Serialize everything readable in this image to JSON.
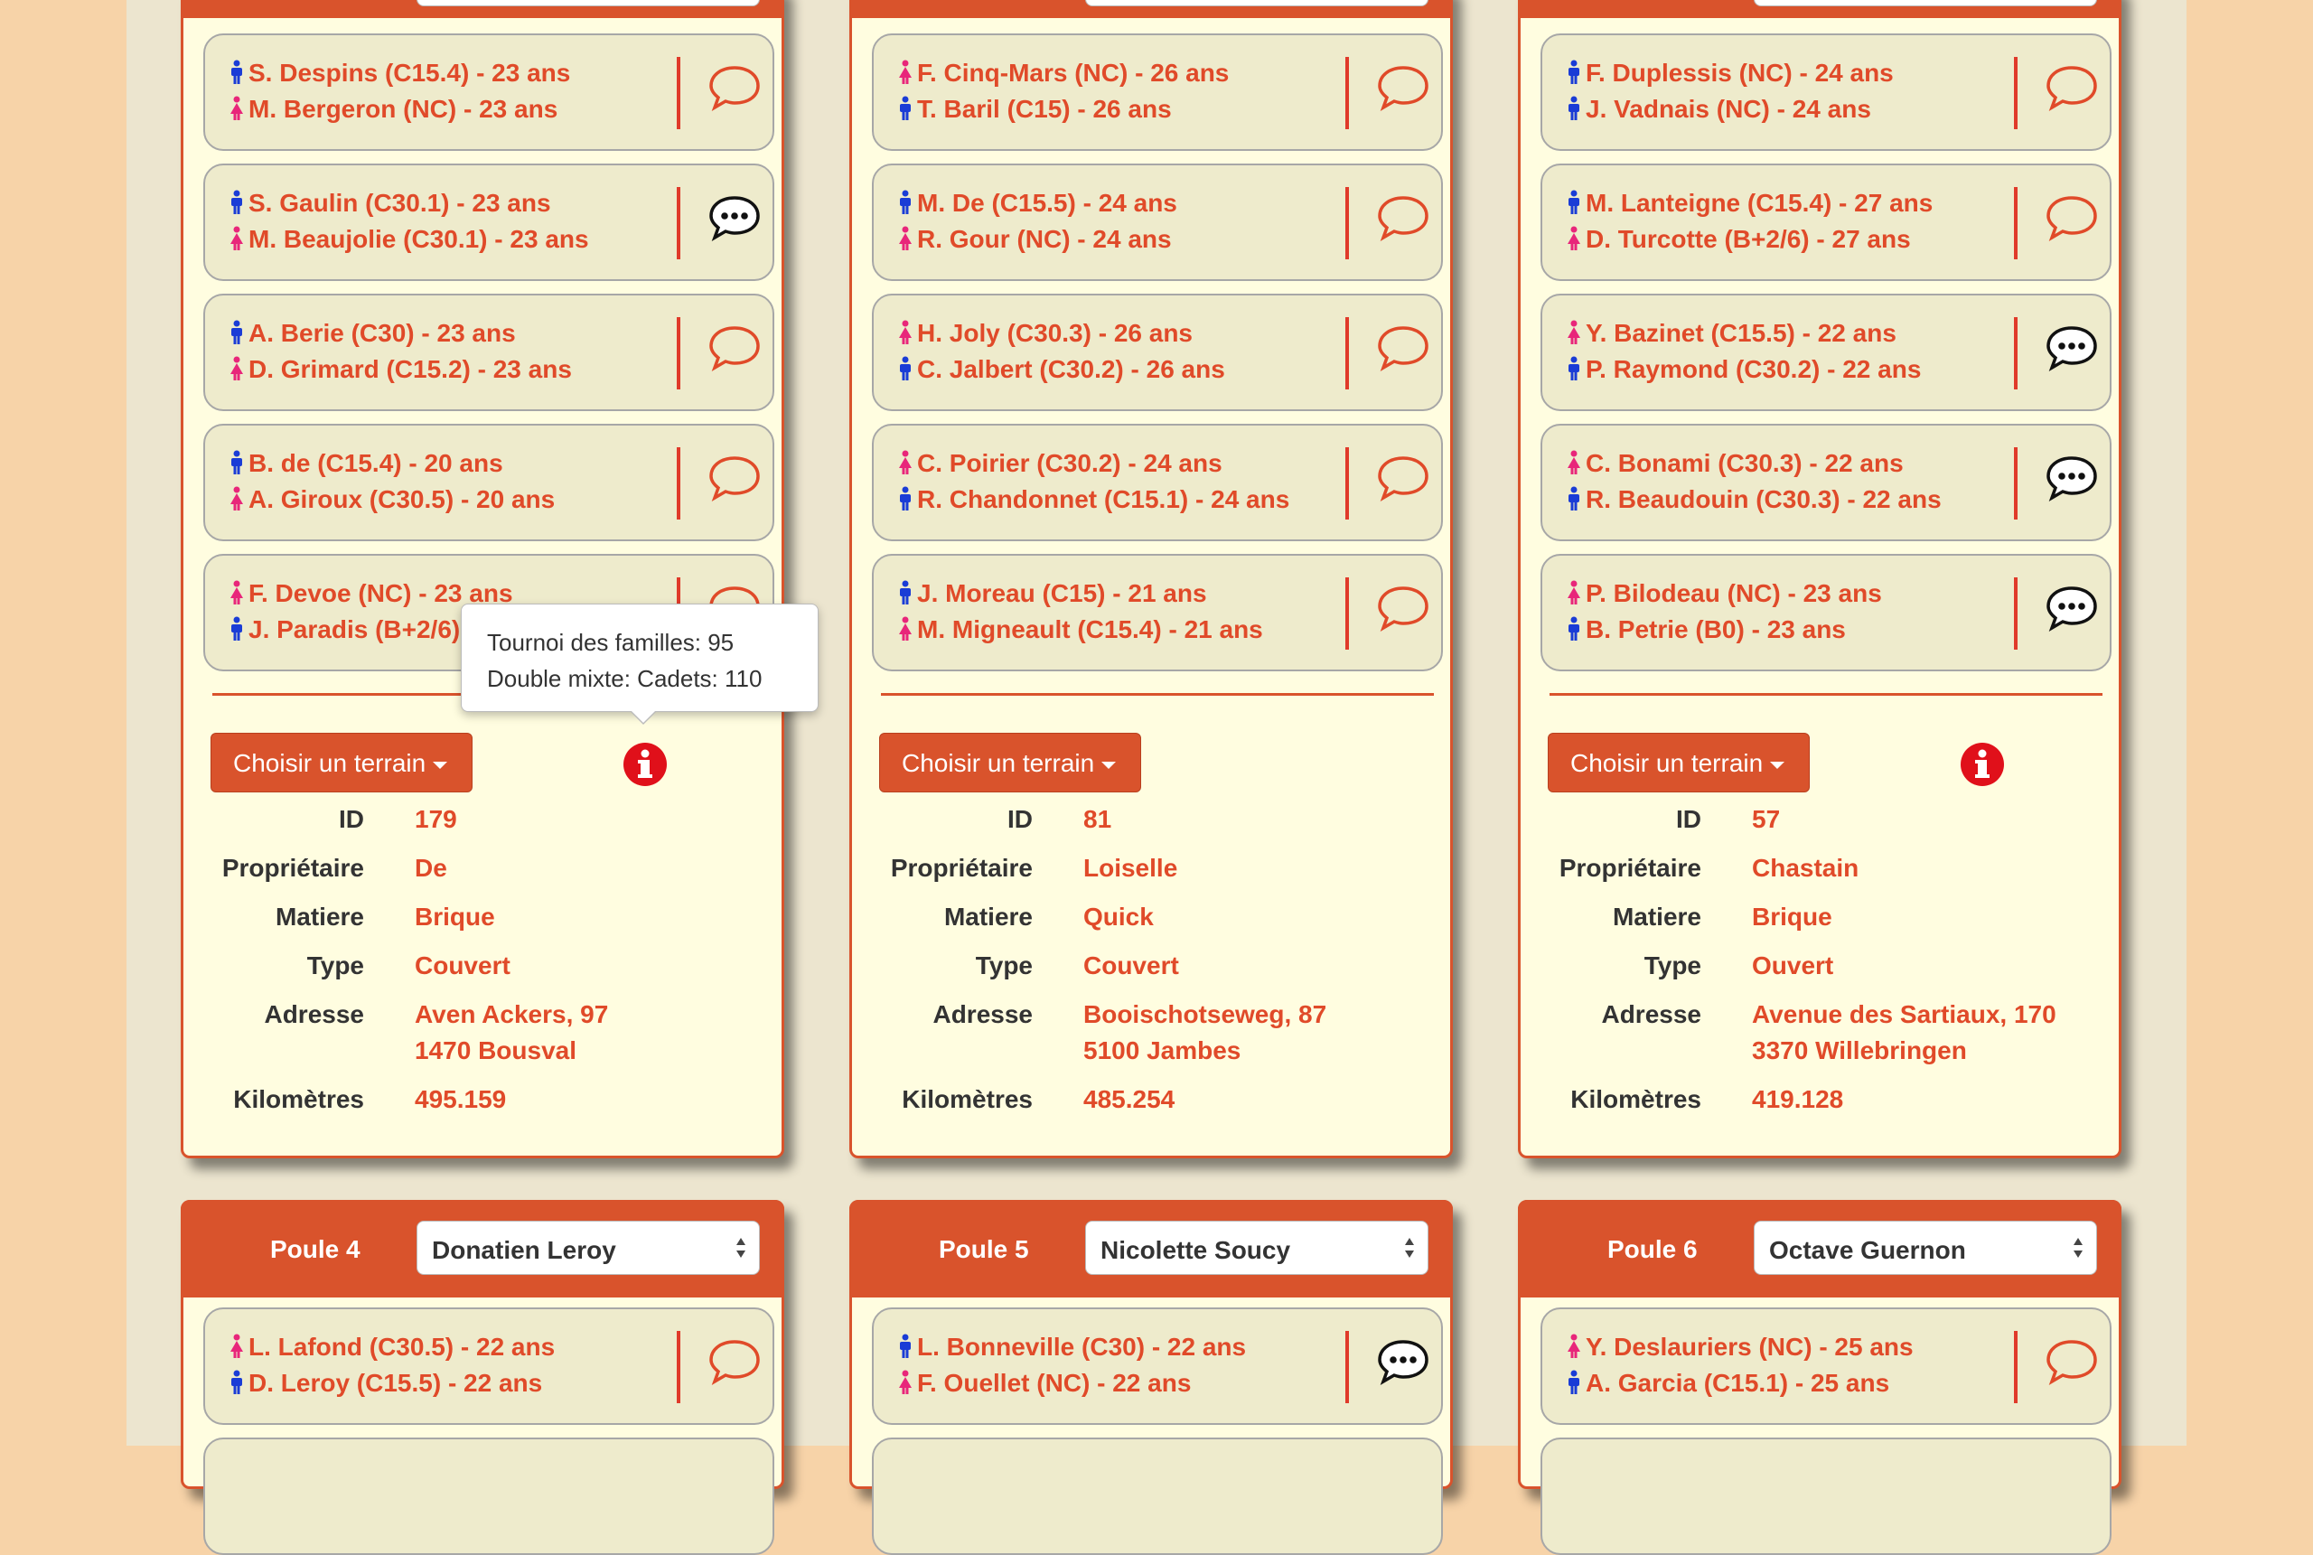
{
  "colors": {
    "accent": "#d9532c",
    "text_red": "#e04a29",
    "male": "#1a3cd6",
    "female": "#e8267a",
    "panel_bg": "#fffde0",
    "card_bg": "#eeebcc"
  },
  "top_panels": [
    {
      "pairs": [
        {
          "p1": {
            "gender": "male",
            "text": "S. Despins (C15.4) - 23 ans"
          },
          "p2": {
            "gender": "female",
            "text": "M. Bergeron (NC) - 23 ans"
          },
          "chat": "empty"
        },
        {
          "p1": {
            "gender": "male",
            "text": "S. Gaulin (C30.1) - 23 ans"
          },
          "p2": {
            "gender": "female",
            "text": "M. Beaujolie (C30.1) - 23 ans"
          },
          "chat": "filled"
        },
        {
          "p1": {
            "gender": "male",
            "text": "A. Berie (C30) - 23 ans"
          },
          "p2": {
            "gender": "female",
            "text": "D. Grimard (C15.2) - 23 ans"
          },
          "chat": "empty"
        },
        {
          "p1": {
            "gender": "male",
            "text": "B. de (C15.4) - 20 ans"
          },
          "p2": {
            "gender": "female",
            "text": "A. Giroux (C30.5) - 20 ans"
          },
          "chat": "empty"
        },
        {
          "p1": {
            "gender": "female",
            "text": "F. Devoe (NC) - 23 ans"
          },
          "p2": {
            "gender": "male",
            "text": "J. Paradis (B+2/6) - 23 ans"
          },
          "chat": "empty"
        }
      ],
      "terrain_button": "Choisir un terrain",
      "details": {
        "id": "179",
        "proprietaire": "De",
        "matiere": "Brique",
        "type": "Couvert",
        "adresse1": "Aven Ackers, 97",
        "adresse2": "1470 Bousval",
        "km": "495.159"
      }
    },
    {
      "pairs": [
        {
          "p1": {
            "gender": "female",
            "text": "F. Cinq-Mars (NC) - 26 ans"
          },
          "p2": {
            "gender": "male",
            "text": "T. Baril (C15) - 26 ans"
          },
          "chat": "empty"
        },
        {
          "p1": {
            "gender": "male",
            "text": "M. De (C15.5) - 24 ans"
          },
          "p2": {
            "gender": "female",
            "text": "R. Gour (NC) - 24 ans"
          },
          "chat": "empty"
        },
        {
          "p1": {
            "gender": "female",
            "text": "H. Joly (C30.3) - 26 ans"
          },
          "p2": {
            "gender": "male",
            "text": "C. Jalbert (C30.2) - 26 ans"
          },
          "chat": "empty"
        },
        {
          "p1": {
            "gender": "female",
            "text": "C. Poirier (C30.2) - 24 ans"
          },
          "p2": {
            "gender": "male",
            "text": "R. Chandonnet (C15.1) - 24 ans"
          },
          "chat": "empty"
        },
        {
          "p1": {
            "gender": "male",
            "text": "J. Moreau (C15) - 21 ans"
          },
          "p2": {
            "gender": "female",
            "text": "M. Migneault (C15.4) - 21 ans"
          },
          "chat": "empty"
        }
      ],
      "terrain_button": "Choisir un terrain",
      "details": {
        "id": "81",
        "proprietaire": "Loiselle",
        "matiere": "Quick",
        "type": "Couvert",
        "adresse1": "Booischotseweg, 87",
        "adresse2": "5100 Jambes",
        "km": "485.254"
      }
    },
    {
      "pairs": [
        {
          "p1": {
            "gender": "male",
            "text": "F. Duplessis (NC) - 24 ans"
          },
          "p2": {
            "gender": "male",
            "text": "J. Vadnais (NC) - 24 ans"
          },
          "chat": "empty"
        },
        {
          "p1": {
            "gender": "male",
            "text": "M. Lanteigne (C15.4) - 27 ans"
          },
          "p2": {
            "gender": "female",
            "text": "D. Turcotte (B+2/6) - 27 ans"
          },
          "chat": "empty"
        },
        {
          "p1": {
            "gender": "female",
            "text": "Y. Bazinet (C15.5) - 22 ans"
          },
          "p2": {
            "gender": "male",
            "text": "P. Raymond (C30.2) - 22 ans"
          },
          "chat": "filled"
        },
        {
          "p1": {
            "gender": "female",
            "text": "C. Bonami (C30.3) - 22 ans"
          },
          "p2": {
            "gender": "male",
            "text": "R. Beaudouin (C30.3) - 22 ans"
          },
          "chat": "filled"
        },
        {
          "p1": {
            "gender": "female",
            "text": "P. Bilodeau (NC) - 23 ans"
          },
          "p2": {
            "gender": "male",
            "text": "B. Petrie (B0) - 23 ans"
          },
          "chat": "filled"
        }
      ],
      "terrain_button": "Choisir un terrain",
      "details": {
        "id": "57",
        "proprietaire": "Chastain",
        "matiere": "Brique",
        "type": "Ouvert",
        "adresse1": "Avenue des Sartiaux, 170",
        "adresse2": "3370 Willebringen",
        "km": "419.128"
      }
    }
  ],
  "detail_labels": {
    "id": "ID",
    "proprietaire": "Propriétaire",
    "matiere": "Matiere",
    "type": "Type",
    "adresse": "Adresse",
    "km": "Kilomètres"
  },
  "tooltip": {
    "line1": "Tournoi des familles: 95",
    "line2": "Double mixte: Cadets: 110"
  },
  "bottom_panels": [
    {
      "label": "Poule 4",
      "select": "Donatien Leroy",
      "pair": {
        "p1": {
          "gender": "female",
          "text": "L. Lafond (C30.5) - 22 ans"
        },
        "p2": {
          "gender": "male",
          "text": "D. Leroy (C15.5) - 22 ans"
        },
        "chat": "empty"
      }
    },
    {
      "label": "Poule 5",
      "select": "Nicolette Soucy",
      "pair": {
        "p1": {
          "gender": "male",
          "text": "L. Bonneville (C30) - 22 ans"
        },
        "p2": {
          "gender": "female",
          "text": "F. Ouellet (NC) - 22 ans"
        },
        "chat": "filled"
      }
    },
    {
      "label": "Poule 6",
      "select": "Octave Guernon",
      "pair": {
        "p1": {
          "gender": "female",
          "text": "Y. Deslauriers (NC) - 25 ans"
        },
        "p2": {
          "gender": "male",
          "text": "A. Garcia (C15.1) - 25 ans"
        },
        "chat": "empty"
      }
    }
  ]
}
